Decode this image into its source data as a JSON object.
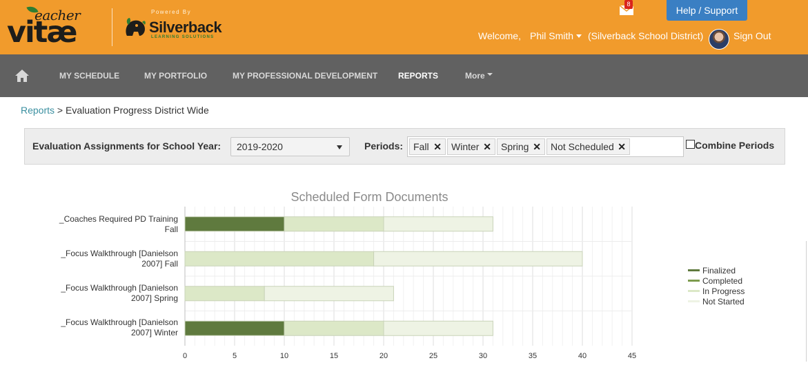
{
  "header": {
    "logo_text": "teacher vitae",
    "powered_by": "Powered By",
    "partner_brand": "Silverback",
    "partner_tagline": "LEARNING SOLUTIONS",
    "mail_count": "8",
    "help_label": "Help / Support",
    "welcome": "Welcome,",
    "user_name": "Phil Smith",
    "district": "(Silverback School District)",
    "signout_label": "Sign Out"
  },
  "nav": {
    "items": [
      {
        "label": "MY SCHEDULE"
      },
      {
        "label": "MY PORTFOLIO"
      },
      {
        "label": "MY PROFESSIONAL DEVELOPMENT"
      },
      {
        "label": "REPORTS"
      },
      {
        "label": "More"
      }
    ],
    "active": "REPORTS"
  },
  "breadcrumb": {
    "link": "Reports",
    "separator": ">",
    "current": "Evaluation Progress District Wide"
  },
  "filters": {
    "year_label": "Evaluation Assignments for School Year:",
    "year_value": "2019-2020",
    "periods_label": "Periods:",
    "periods": [
      "Fall",
      "Winter",
      "Spring",
      "Not Scheduled"
    ],
    "remove_glyph": "✕",
    "combine_label": "Combine Periods",
    "combine_checked": false
  },
  "chart_data": {
    "type": "bar",
    "orientation": "horizontal",
    "stacked": true,
    "title": "Scheduled Form Documents",
    "categories": [
      [
        "_Coaches Required PD Training",
        "Fall"
      ],
      [
        "_Focus Walkthrough [Danielson",
        "2007] Fall"
      ],
      [
        "_Focus Walkthrough [Danielson",
        "2007] Spring"
      ],
      [
        "_Focus Walkthrough [Danielson",
        "2007] Winter"
      ]
    ],
    "series": [
      {
        "name": "Finalized",
        "color": "#5f7a3e",
        "values": [
          10,
          0,
          0,
          10
        ]
      },
      {
        "name": "Completed",
        "color": "#7d9b4d",
        "values": [
          0,
          0,
          0,
          0
        ]
      },
      {
        "name": "In Progress",
        "color": "#dce8c7",
        "values": [
          10,
          19,
          8,
          10
        ]
      },
      {
        "name": "Not Started",
        "color": "#eef3e4",
        "values": [
          11,
          21,
          13,
          11
        ]
      }
    ],
    "xlim": [
      0,
      45
    ],
    "xticks": [
      0,
      5,
      10,
      15,
      20,
      25,
      30,
      35,
      40,
      45
    ],
    "grid": true,
    "legend_position": "right"
  }
}
